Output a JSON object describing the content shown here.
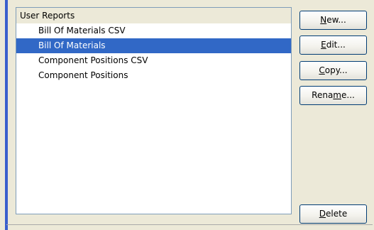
{
  "reports": {
    "group_label": "User Reports",
    "items": [
      {
        "label": "Bill Of Materials CSV",
        "selected": false
      },
      {
        "label": "Bill Of Materials",
        "selected": true
      },
      {
        "label": "Component Positions CSV",
        "selected": false
      },
      {
        "label": "Component Positions",
        "selected": false
      }
    ]
  },
  "buttons": {
    "new": {
      "pre": "",
      "key": "N",
      "post": "ew..."
    },
    "edit": {
      "pre": "",
      "key": "E",
      "post": "dit..."
    },
    "copy": {
      "pre": "",
      "key": "C",
      "post": "opy..."
    },
    "rename": {
      "pre": "Rena",
      "key": "m",
      "post": "e..."
    },
    "delete": {
      "pre": "",
      "key": "D",
      "post": "elete"
    }
  },
  "colors": {
    "selection": "#3168c6",
    "accent": "#3a5fcd",
    "window_bg": "#ece9d8"
  }
}
